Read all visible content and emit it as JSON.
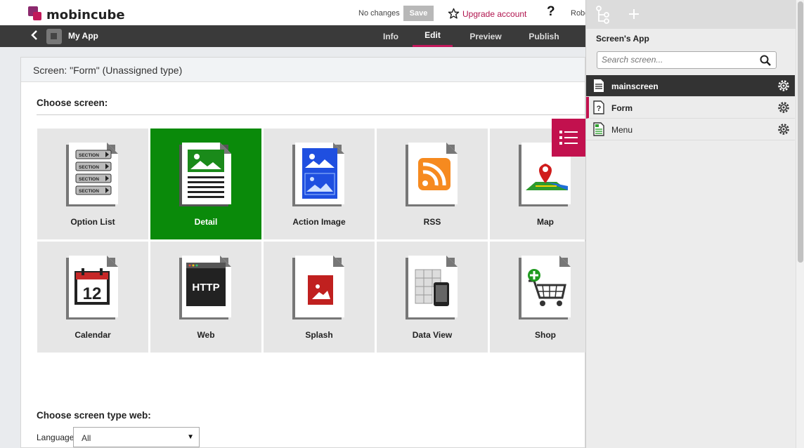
{
  "header": {
    "logo_text": "mobincube",
    "status": "No changes",
    "save_label": "Save",
    "upgrade_label": "Upgrade account",
    "help_label": "?",
    "user_name": "Robe"
  },
  "nav": {
    "app_name": "My App",
    "tabs": [
      {
        "label": "Info"
      },
      {
        "label": "Edit",
        "active": true
      },
      {
        "label": "Preview"
      },
      {
        "label": "Publish"
      }
    ]
  },
  "panel": {
    "header": "Screen: \"Form\" (Unassigned type)",
    "choose_screen": "Choose screen:",
    "tiles": [
      {
        "label": "Option List",
        "icon": "option-list-icon"
      },
      {
        "label": "Detail",
        "icon": "detail-icon",
        "selected": true
      },
      {
        "label": "Action Image",
        "icon": "action-image-icon"
      },
      {
        "label": "RSS",
        "icon": "rss-icon"
      },
      {
        "label": "Map",
        "icon": "map-icon"
      },
      {
        "label": "Calendar",
        "icon": "calendar-icon"
      },
      {
        "label": "Web",
        "icon": "web-icon"
      },
      {
        "label": "Splash",
        "icon": "splash-icon"
      },
      {
        "label": "Data View",
        "icon": "data-view-icon"
      },
      {
        "label": "Shop",
        "icon": "shop-icon"
      }
    ],
    "section_labels": [
      "SECTION",
      "SECTION",
      "SECTION",
      "SECTION"
    ],
    "calendar_day": "12",
    "web_text": "HTTP",
    "choose_web": "Choose screen type web:",
    "language_label": "Language",
    "language_value": "All"
  },
  "sidebar": {
    "title": "Screen's App",
    "search_placeholder": "Search screen...",
    "items": [
      {
        "name": "mainscreen",
        "icon": "document-icon"
      },
      {
        "name": "Form",
        "icon": "question-document-icon"
      },
      {
        "name": "Menu",
        "icon": "menu-document-icon"
      }
    ]
  },
  "colors": {
    "accent": "#c2114e",
    "selected_tile": "#0a8a0a",
    "navbar": "#3a3a3a"
  }
}
